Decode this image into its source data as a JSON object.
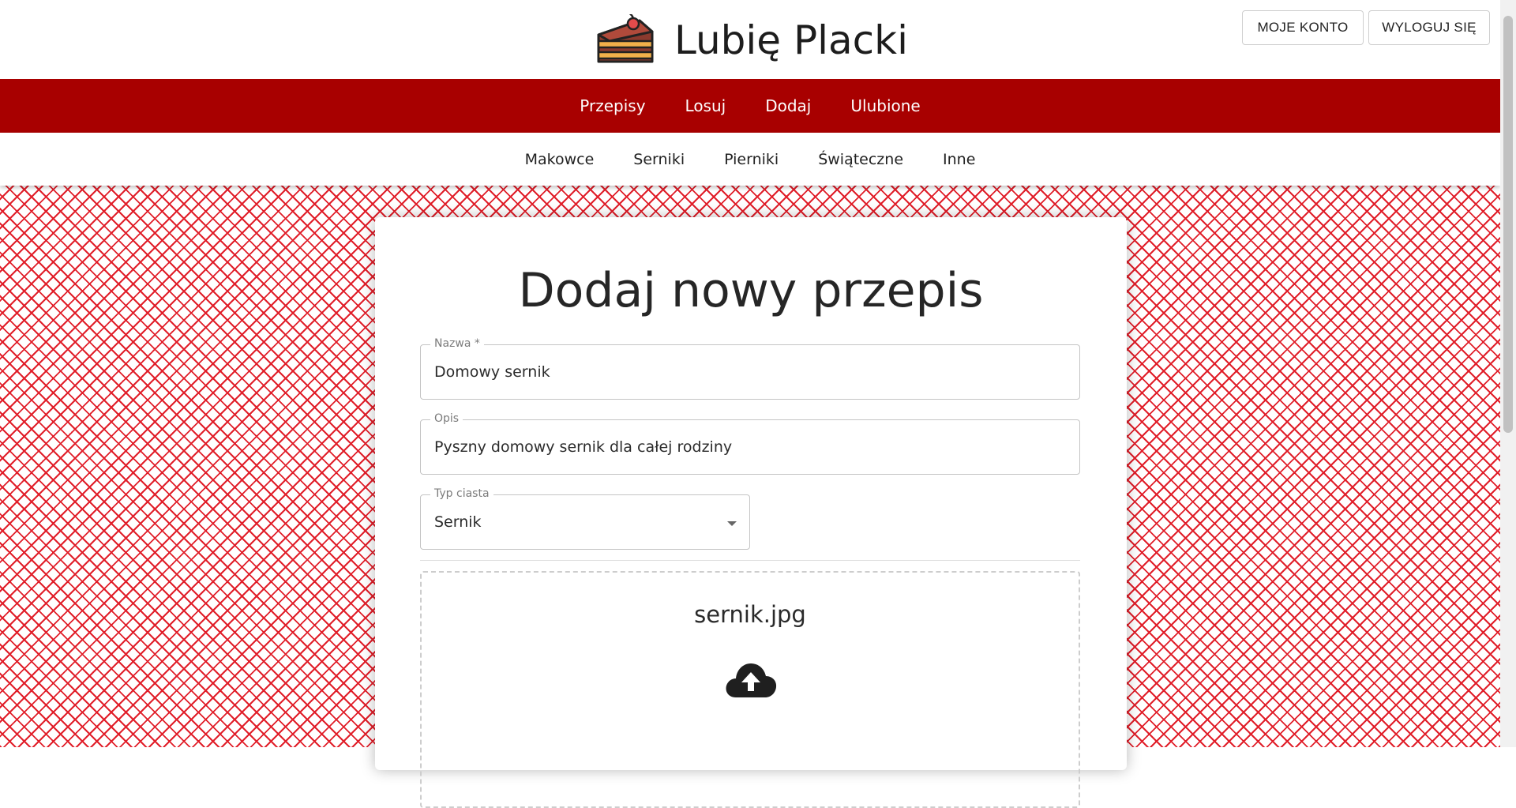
{
  "header": {
    "brand_title": "Lubię Placki",
    "account_button": "MOJE KONTO",
    "logout_button": "WYLOGUJ SIĘ"
  },
  "main_nav": {
    "items": [
      "Przepisy",
      "Losuj",
      "Dodaj",
      "Ulubione"
    ]
  },
  "sub_nav": {
    "items": [
      "Makowce",
      "Serniki",
      "Pierniki",
      "Świąteczne",
      "Inne"
    ]
  },
  "form": {
    "title": "Dodaj nowy przepis",
    "name_label": "Nazwa *",
    "name_value": "Domowy sernik",
    "desc_label": "Opis",
    "desc_value": "Pyszny domowy sernik dla całej rodziny",
    "type_label": "Typ ciasta",
    "type_value": "Sernik",
    "file_name": "sernik.jpg"
  },
  "colors": {
    "nav_red": "#a80000",
    "pattern_red": "#e11f2a"
  },
  "icons": {
    "brand_logo": "cake-slice-icon",
    "upload": "cloud-upload-icon",
    "select": "caret-down-icon"
  }
}
